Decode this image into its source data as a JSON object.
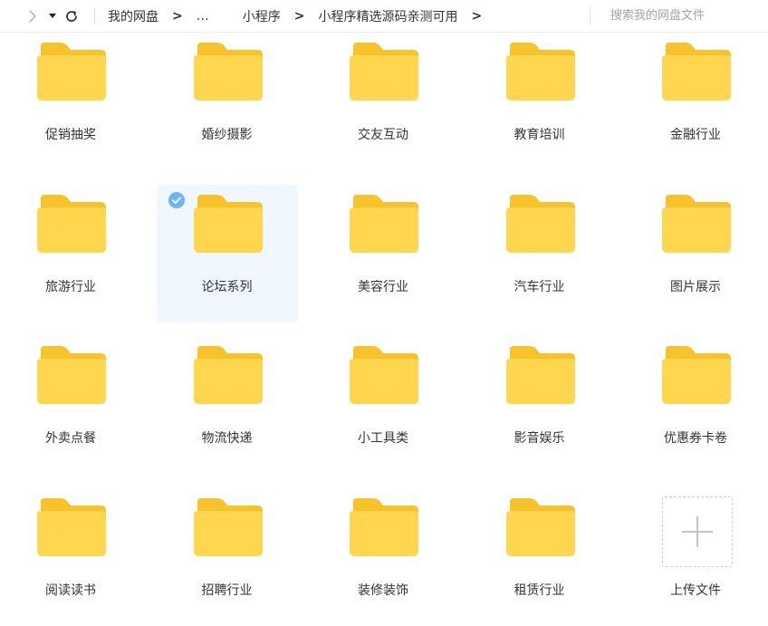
{
  "breadcrumb": {
    "items": [
      "我的网盘",
      "…",
      "小程序",
      "小程序精选源码亲测可用"
    ],
    "separator": ">"
  },
  "search": {
    "placeholder": "搜索我的网盘文件"
  },
  "folders": [
    {
      "name": "促销抽奖"
    },
    {
      "name": "婚纱摄影"
    },
    {
      "name": "交友互动"
    },
    {
      "name": "教育培训"
    },
    {
      "name": "金融行业"
    },
    {
      "name": "旅游行业"
    },
    {
      "name": "论坛系列",
      "selected": true
    },
    {
      "name": "美容行业"
    },
    {
      "name": "汽车行业"
    },
    {
      "name": "图片展示"
    },
    {
      "name": "外卖点餐"
    },
    {
      "name": "物流快递"
    },
    {
      "name": "小工具类"
    },
    {
      "name": "影音娱乐"
    },
    {
      "name": "优惠券卡卷"
    },
    {
      "name": "阅读读书"
    },
    {
      "name": "招聘行业"
    },
    {
      "name": "装修装饰"
    },
    {
      "name": "租赁行业"
    }
  ],
  "upload": {
    "label": "上传文件"
  },
  "colors": {
    "folder_back": "#f8c22b",
    "folder_front": "#ffd64d",
    "selected_bg": "#f0f7ff",
    "check": "#6cb4f7"
  },
  "icons": {
    "forward": "chevron-right-icon",
    "dropdown": "caret-down-icon",
    "refresh": "refresh-icon",
    "folder": "folder-icon",
    "check": "check-circle-icon",
    "upload": "plus-icon"
  }
}
